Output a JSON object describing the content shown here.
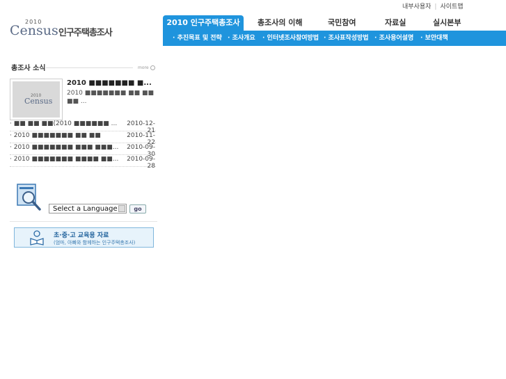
{
  "util_links": [
    "내부사용자",
    "사이트맵"
  ],
  "logo": {
    "year": "2010",
    "brand": "Census",
    "name": "인구주택총조사"
  },
  "nav": {
    "items": [
      "2010 인구주택총조사",
      "총조사의 이해",
      "국민참여",
      "자료실",
      "실시본부"
    ],
    "sub_items": [
      "추진목표 및 전략",
      "조사개요",
      "인터넷조사참여방법",
      "조사표작성방법",
      "조사용어설명",
      "보안대책"
    ]
  },
  "news": {
    "title": "총조사 소식",
    "more_label": "more",
    "thumb": {
      "year": "2010",
      "brand": "Census"
    },
    "featured_title": "2010 ■■■■■■■ ■...",
    "featured_body": "2010 ■■■■■■■ ■■ ■■ ■■ ...",
    "items": [
      {
        "title": "■■ ■■ ■■(2010 ■■■■■■ ...",
        "date": "2010-12-21"
      },
      {
        "title": "2010 ■■■■■■■ ■■ ■■",
        "date": "2010-11-22"
      },
      {
        "title": "2010 ■■■■■■■ ■■■ ■■■...",
        "date": "2010-09-30"
      },
      {
        "title": "2010 ■■■■■■■ ■■■■ ■■...",
        "date": "2010-09-28"
      }
    ]
  },
  "language": {
    "selected": "Select a Language",
    "go_label": "go"
  },
  "edu_banner": {
    "line1": "초·중·고 교육용 자료",
    "line2": "(엄마, 아빠와 함께하는 인구주택총조사)"
  }
}
